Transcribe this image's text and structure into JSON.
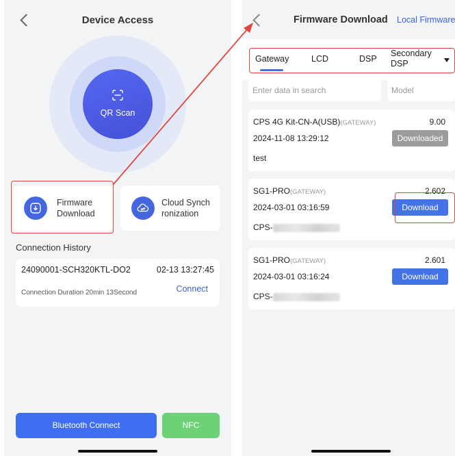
{
  "left_screen": {
    "title": "Device Access",
    "qr_label": "QR Scan",
    "tiles": [
      {
        "label_line1": "Firmware",
        "label_line2": "Download"
      },
      {
        "label_line1": "Cloud Synch",
        "label_line2": "ronization"
      }
    ],
    "history_title": "Connection History",
    "history": {
      "device": "24090001-SCH320KTL-DO2",
      "time": "02-13 13:27:45",
      "duration": "Connection Duration 20min 13Second",
      "connect_label": "Connect"
    },
    "bluetooth_label": "Bluetooth Connect",
    "nfc_label": "NFC"
  },
  "right_screen": {
    "title": "Firmware Download",
    "local_link": "Local Firmware",
    "tabs": [
      {
        "label": "Gateway",
        "active": true
      },
      {
        "label": "LCD"
      },
      {
        "label": "DSP"
      },
      {
        "label": "Secondary DSP"
      }
    ],
    "search_placeholder": "Enter data in search",
    "model_placeholder": "Model",
    "firmware": [
      {
        "name": "CPS 4G Kit-CN-A(USB)",
        "tag": "(GATEWAY)",
        "version": "9.00",
        "date": "2024-11-08 13:29:12",
        "desc": "test",
        "button": "Downloaded"
      },
      {
        "name": "SG1-PRO",
        "tag": "(GATEWAY)",
        "version": "2.602",
        "date": "2024-03-01 03:16:59",
        "desc": "CPS-",
        "button": "Download"
      },
      {
        "name": "SG1-PRO",
        "tag": "(GATEWAY)",
        "version": "2.601",
        "date": "2024-03-01 03:16:24",
        "desc": "CPS-",
        "button": "Download"
      }
    ]
  },
  "colors": {
    "accent": "#3f6ef0",
    "highlight": "#e0453e",
    "nfc": "#6dd276",
    "disabled": "#9c9c9c"
  }
}
